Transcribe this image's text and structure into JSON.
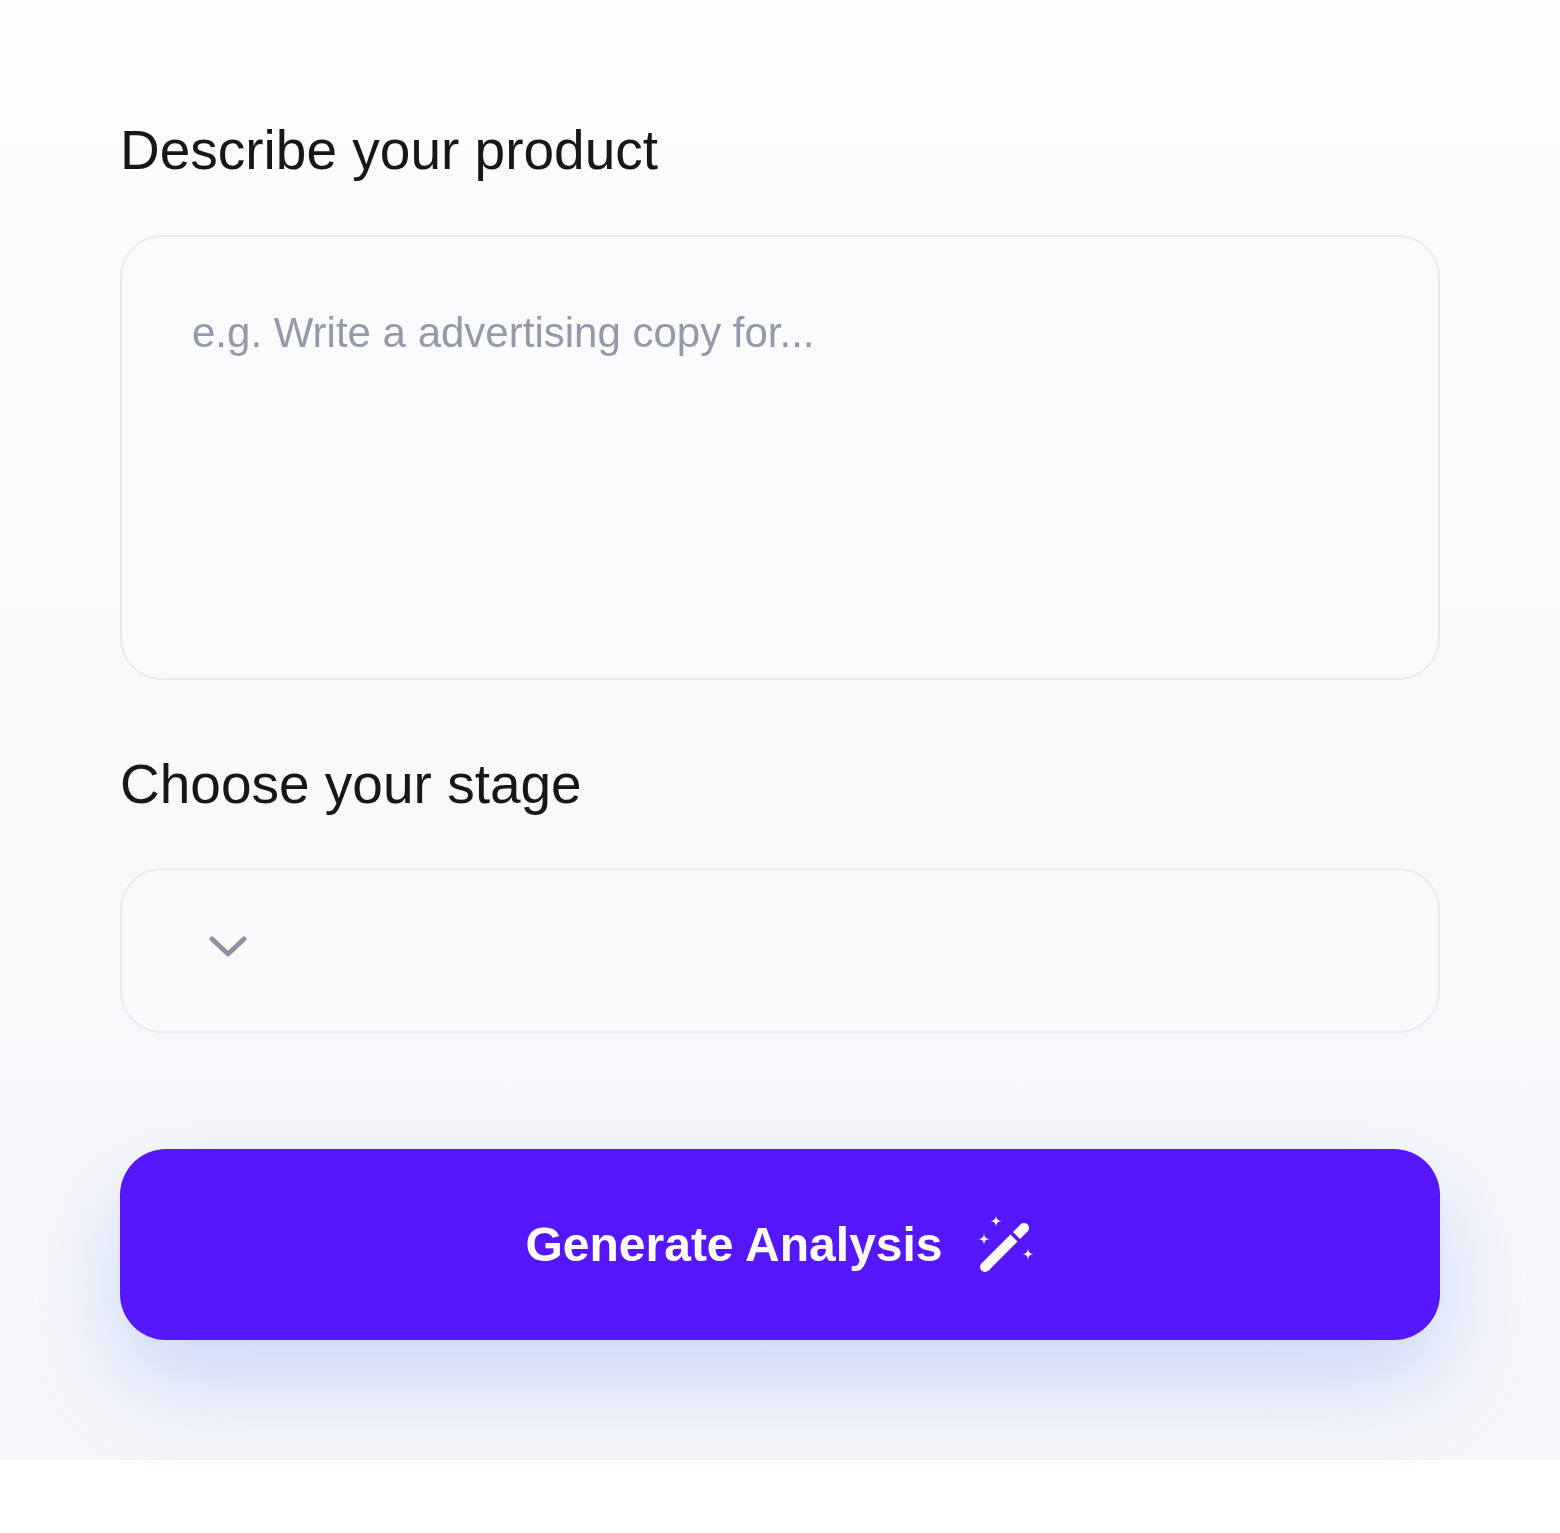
{
  "form": {
    "fields": [
      {
        "kind": "textarea",
        "label": "Describe your product",
        "placeholder": "e.g. Write a advertising copy for..."
      },
      {
        "kind": "select",
        "label": "Choose your stage"
      }
    ]
  },
  "submit_button": {
    "label": "Generate Analysis"
  }
}
